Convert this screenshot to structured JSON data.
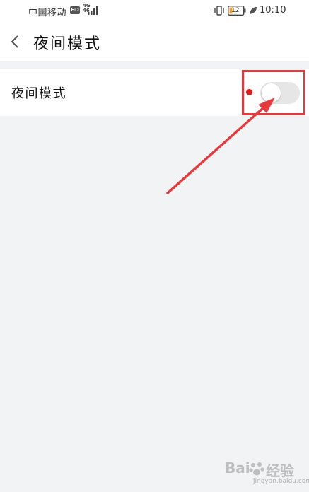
{
  "status_bar": {
    "carrier": "中国移动",
    "hd": "HD",
    "network_top": "4G",
    "network_bottom": "46",
    "battery": "12",
    "time": "10:10"
  },
  "header": {
    "title": "夜间模式"
  },
  "settings": {
    "night_mode": {
      "label": "夜间模式",
      "enabled": false
    }
  },
  "watermark": {
    "brand_left": "Bai",
    "brand_right": "经验",
    "sub": "jingyan.baidu.com"
  },
  "colors": {
    "highlight": "#e0393e",
    "dot": "#e21b1b",
    "toggle_off": "#e6e6e6",
    "background": "#f2f3f5"
  },
  "icons": {
    "back": "chevron-left-icon",
    "signal": "signal-icon",
    "vibrate": "vibrate-icon",
    "battery": "battery-icon",
    "leaf": "leaf-icon"
  }
}
